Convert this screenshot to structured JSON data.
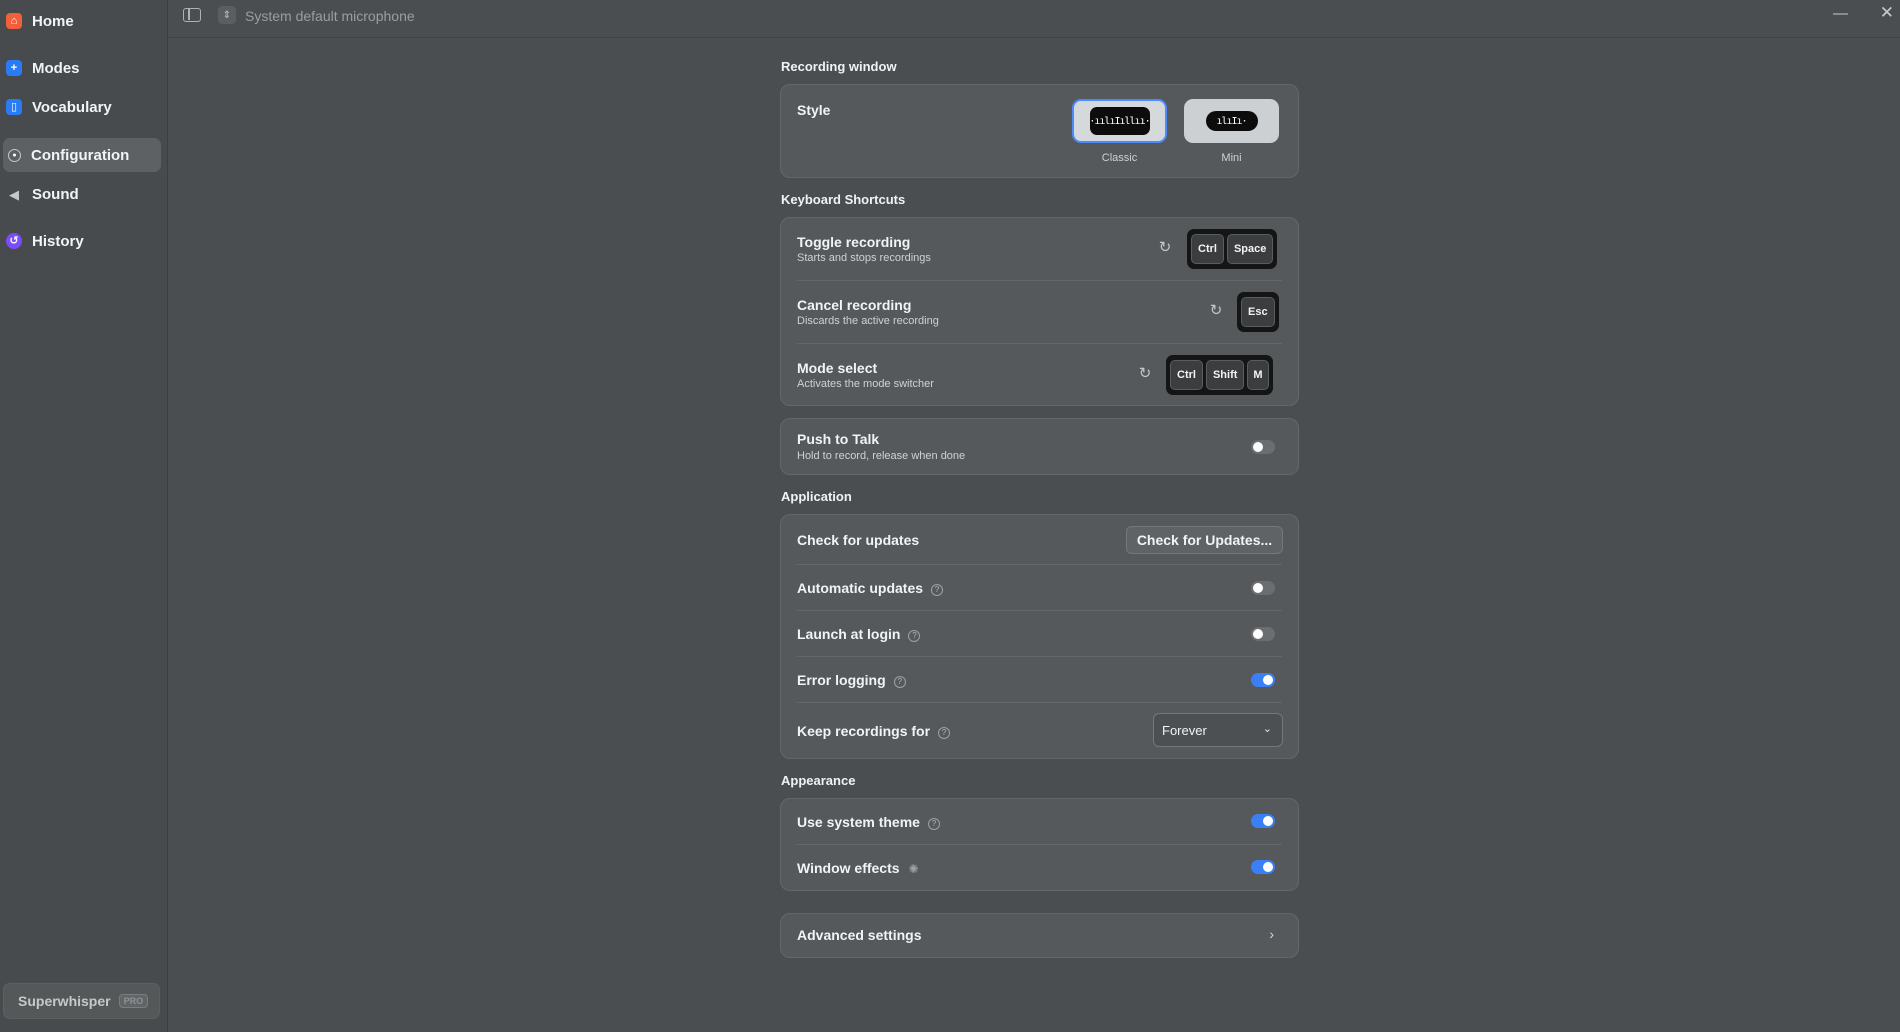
{
  "sidebar": {
    "items": [
      {
        "label": "Home",
        "icon": "home-icon",
        "color": "#f25f3a"
      },
      {
        "label": "Modes",
        "icon": "plus-icon",
        "color": "#2a7cf6"
      },
      {
        "label": "Vocabulary",
        "icon": "book-icon",
        "color": "#2a7cf6"
      },
      {
        "label": "Configuration",
        "icon": "gear-icon",
        "color": "#c5c8ca"
      },
      {
        "label": "Sound",
        "icon": "speaker-icon",
        "color": "#c5c8ca"
      },
      {
        "label": "History",
        "icon": "history-icon",
        "color": "#7a4dfc"
      }
    ],
    "brand": {
      "name": "Superwhisper",
      "badge": "PRO"
    }
  },
  "topbar": {
    "microphone": "System default microphone"
  },
  "recording_window": {
    "section_title": "Recording window",
    "style_label": "Style",
    "options": [
      {
        "label": "Classic",
        "selected": true
      },
      {
        "label": "Mini",
        "selected": false
      }
    ]
  },
  "keyboard_shortcuts": {
    "section_title": "Keyboard Shortcuts",
    "rows": [
      {
        "title": "Toggle recording",
        "subtitle": "Starts and stops recordings",
        "keys": [
          "Ctrl",
          "Space"
        ]
      },
      {
        "title": "Cancel recording",
        "subtitle": "Discards the active recording",
        "keys": [
          "Esc"
        ]
      },
      {
        "title": "Mode select",
        "subtitle": "Activates the mode switcher",
        "keys": [
          "Ctrl",
          "Shift",
          "M"
        ]
      }
    ]
  },
  "push_to_talk": {
    "title": "Push to Talk",
    "subtitle": "Hold to record, release when done",
    "enabled": false
  },
  "application": {
    "section_title": "Application",
    "check_updates": {
      "label": "Check for updates",
      "button": "Check for Updates..."
    },
    "automatic_updates": {
      "label": "Automatic updates",
      "enabled": false
    },
    "launch_at_login": {
      "label": "Launch at login",
      "enabled": false
    },
    "error_logging": {
      "label": "Error logging",
      "enabled": true
    },
    "keep_recordings": {
      "label": "Keep recordings for",
      "value": "Forever"
    }
  },
  "appearance": {
    "section_title": "Appearance",
    "use_system_theme": {
      "label": "Use system theme",
      "enabled": true
    },
    "window_effects": {
      "label": "Window effects",
      "enabled": true
    }
  },
  "advanced": {
    "label": "Advanced settings"
  },
  "colors": {
    "accent": "#3b7ff6",
    "background": "#4a4e51",
    "card": "#55595c"
  }
}
